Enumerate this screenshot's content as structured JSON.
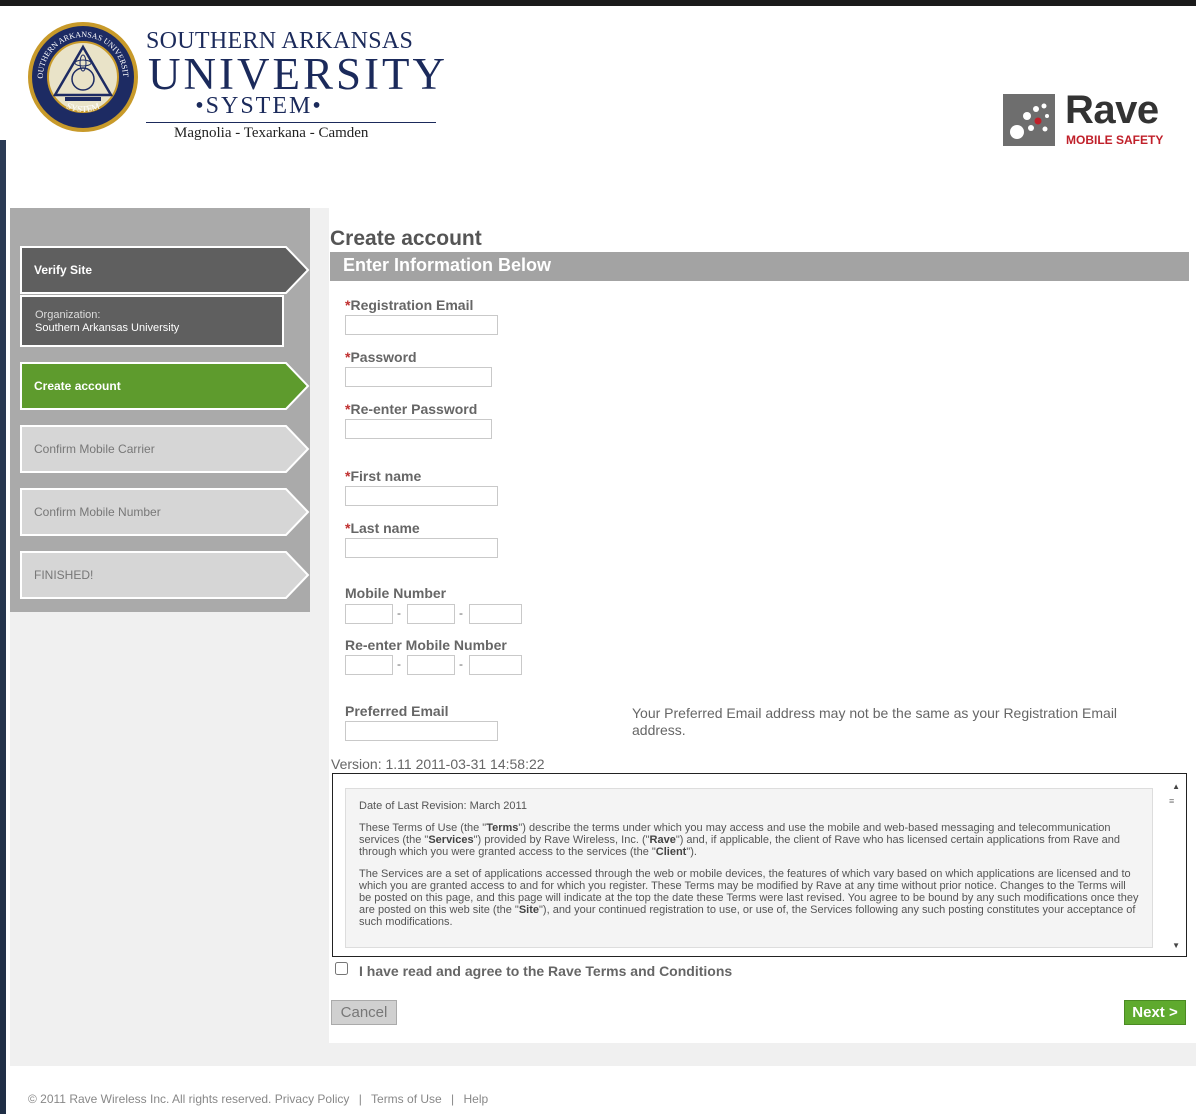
{
  "header": {
    "sau": {
      "line1": "SOUTHERN ARKANSAS",
      "line2": "UNIVERSITY",
      "line3": "•SYSTEM•",
      "line4": "Magnolia - Texarkana - Camden",
      "seal_top": "SOUTHERN ARKANSAS UNIVERSITY",
      "seal_bottom": "SYSTEM"
    },
    "rave": {
      "word": "Rave",
      "sub": "MOBILE SAFETY"
    }
  },
  "sidebar": {
    "steps": [
      {
        "label": "Verify Site",
        "state": "done"
      },
      {
        "label": "Create account",
        "state": "active"
      },
      {
        "label": "Confirm Mobile Carrier",
        "state": "pending"
      },
      {
        "label": "Confirm Mobile Number",
        "state": "pending"
      },
      {
        "label": "FINISHED!",
        "state": "pending"
      }
    ],
    "org": {
      "label": "Organization:",
      "value": "Southern Arkansas University"
    }
  },
  "main": {
    "title": "Create account",
    "section": "Enter Information Below",
    "required_mark": "*",
    "fields": {
      "registration_email": {
        "label": "Registration Email",
        "value": ""
      },
      "password": {
        "label": "Password",
        "value": ""
      },
      "reenter_password": {
        "label": "Re-enter Password",
        "value": ""
      },
      "first_name": {
        "label": "First name",
        "value": ""
      },
      "last_name": {
        "label": "Last name",
        "value": ""
      },
      "mobile_number": {
        "label": "Mobile Number",
        "parts": [
          "",
          "",
          ""
        ]
      },
      "reenter_mobile": {
        "label": "Re-enter Mobile Number",
        "parts": [
          "",
          "",
          ""
        ]
      },
      "preferred_email": {
        "label": "Preferred Email",
        "value": ""
      }
    },
    "dash": "-",
    "preferred_note": "Your Preferred Email address may not be the same as your Registration Email address.",
    "version": "Version: 1.11 2011-03-31 14:58:22",
    "terms": {
      "revision": "Date of Last Revision: March 2011",
      "p1_a": "These Terms of Use (the \"",
      "p1_terms": "Terms",
      "p1_b": "\") describe the terms under which you may access and use the mobile and web-based messaging and telecommunication services (the \"",
      "p1_services": "Services",
      "p1_c": "\") provided by Rave Wireless, Inc. (\"",
      "p1_rave": "Rave",
      "p1_d": "\") and, if applicable, the client of Rave who has licensed certain applications from Rave and through which you were granted access to the services (the \"",
      "p1_client": "Client",
      "p1_e": "\").",
      "p2_a": "The Services are a set of applications accessed through the web or mobile devices, the features of which vary based on which applications are licensed and to which you are granted access to and for which you register. These Terms may be modified by Rave at any time without prior notice. Changes to the Terms will be posted on this page, and this page will indicate at the top the date these Terms were last revised. You agree to be bound by any such modifications once they are posted on this web site (the \"",
      "p2_site": "Site",
      "p2_b": "\"), and your continued registration to use, or use of, the Services following any such posting constitutes your acceptance of such modifications."
    },
    "agree_label": "I have read and agree to the Rave Terms and Conditions",
    "agree_checked": false,
    "cancel_label": "Cancel",
    "next_label": "Next >"
  },
  "footer": {
    "copyright": "© 2011 Rave Wireless Inc. All rights reserved.",
    "privacy": "Privacy Policy",
    "sep": "|",
    "terms": "Terms of Use",
    "help": "Help"
  },
  "colors": {
    "active_step": "#5e9b2d",
    "done_step": "#5f5f5f",
    "pending_step": "#d6d6d6",
    "next_button": "#5faa2e",
    "rave_red": "#c0202a",
    "sau_navy": "#1b2a5b"
  }
}
